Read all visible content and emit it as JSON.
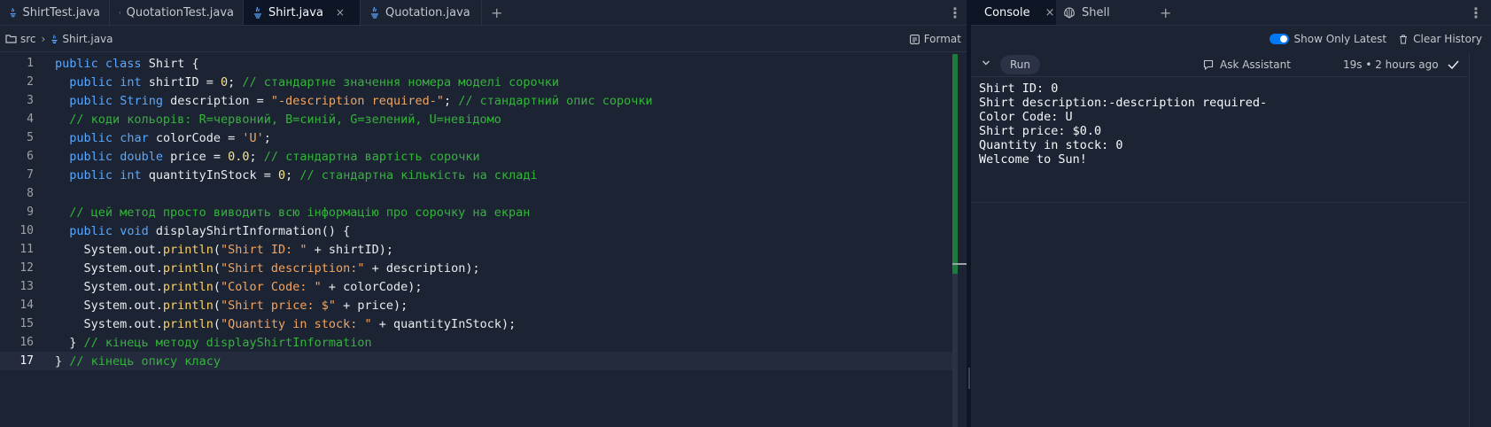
{
  "editor": {
    "tabs": [
      {
        "label": "ShirtTest.java",
        "active": false
      },
      {
        "label": "QuotationTest.java",
        "active": false
      },
      {
        "label": "Shirt.java",
        "active": true,
        "close": "×"
      },
      {
        "label": "Quotation.java",
        "active": false
      }
    ],
    "add_tab": "+",
    "menu": "⋮",
    "breadcrumb": {
      "folder": "src",
      "separator": "›",
      "file": "Shirt.java"
    },
    "format_label": "Format",
    "current_line": 17
  },
  "code_lines": [
    {
      "n": "1",
      "tokens": [
        {
          "c": "kw",
          "t": "public"
        },
        {
          "c": "id",
          "t": " "
        },
        {
          "c": "kw",
          "t": "class"
        },
        {
          "c": "id",
          "t": " Shirt {"
        }
      ]
    },
    {
      "n": "2",
      "tokens": [
        {
          "c": "id",
          "t": "  "
        },
        {
          "c": "kw",
          "t": "public"
        },
        {
          "c": "id",
          "t": " "
        },
        {
          "c": "ty",
          "t": "int"
        },
        {
          "c": "id",
          "t": " shirtID = "
        },
        {
          "c": "nm",
          "t": "0"
        },
        {
          "c": "id",
          "t": "; "
        },
        {
          "c": "cm",
          "t": "// стандартне значення номера моделі сорочки"
        }
      ]
    },
    {
      "n": "3",
      "tokens": [
        {
          "c": "id",
          "t": "  "
        },
        {
          "c": "kw",
          "t": "public"
        },
        {
          "c": "id",
          "t": " "
        },
        {
          "c": "ty",
          "t": "String"
        },
        {
          "c": "id",
          "t": " description = "
        },
        {
          "c": "st",
          "t": "\"-description required-\""
        },
        {
          "c": "id",
          "t": "; "
        },
        {
          "c": "cm",
          "t": "// стандартний опис сорочки"
        }
      ]
    },
    {
      "n": "4",
      "tokens": [
        {
          "c": "id",
          "t": "  "
        },
        {
          "c": "cm",
          "t": "// коди кольорів: R=червоний, B=синій, G=зелений, U=невідомо"
        }
      ]
    },
    {
      "n": "5",
      "tokens": [
        {
          "c": "id",
          "t": "  "
        },
        {
          "c": "kw",
          "t": "public"
        },
        {
          "c": "id",
          "t": " "
        },
        {
          "c": "ty",
          "t": "char"
        },
        {
          "c": "id",
          "t": " colorCode = "
        },
        {
          "c": "st",
          "t": "'U'"
        },
        {
          "c": "id",
          "t": ";"
        }
      ]
    },
    {
      "n": "6",
      "tokens": [
        {
          "c": "id",
          "t": "  "
        },
        {
          "c": "kw",
          "t": "public"
        },
        {
          "c": "id",
          "t": " "
        },
        {
          "c": "ty",
          "t": "double"
        },
        {
          "c": "id",
          "t": " price = "
        },
        {
          "c": "nm",
          "t": "0.0"
        },
        {
          "c": "id",
          "t": "; "
        },
        {
          "c": "cm",
          "t": "// стандартна вартість сорочки"
        }
      ]
    },
    {
      "n": "7",
      "tokens": [
        {
          "c": "id",
          "t": "  "
        },
        {
          "c": "kw",
          "t": "public"
        },
        {
          "c": "id",
          "t": " "
        },
        {
          "c": "ty",
          "t": "int"
        },
        {
          "c": "id",
          "t": " quantityInStock = "
        },
        {
          "c": "nm",
          "t": "0"
        },
        {
          "c": "id",
          "t": "; "
        },
        {
          "c": "cm",
          "t": "// стандартна кількість на складі"
        }
      ]
    },
    {
      "n": "8",
      "tokens": []
    },
    {
      "n": "9",
      "tokens": [
        {
          "c": "id",
          "t": "  "
        },
        {
          "c": "cm",
          "t": "// цей метод просто виводить всю інформацію про сорочку на екран"
        }
      ]
    },
    {
      "n": "10",
      "tokens": [
        {
          "c": "id",
          "t": "  "
        },
        {
          "c": "kw",
          "t": "public"
        },
        {
          "c": "id",
          "t": " "
        },
        {
          "c": "ty",
          "t": "void"
        },
        {
          "c": "id",
          "t": " displayShirtInformation() {"
        }
      ]
    },
    {
      "n": "11",
      "tokens": [
        {
          "c": "id",
          "t": "    System.out."
        },
        {
          "c": "fn",
          "t": "println"
        },
        {
          "c": "id",
          "t": "("
        },
        {
          "c": "st",
          "t": "\"Shirt ID: \""
        },
        {
          "c": "id",
          "t": " + shirtID);"
        }
      ]
    },
    {
      "n": "12",
      "tokens": [
        {
          "c": "id",
          "t": "    System.out."
        },
        {
          "c": "fn",
          "t": "println"
        },
        {
          "c": "id",
          "t": "("
        },
        {
          "c": "st",
          "t": "\"Shirt description:\""
        },
        {
          "c": "id",
          "t": " + description);"
        }
      ]
    },
    {
      "n": "13",
      "tokens": [
        {
          "c": "id",
          "t": "    System.out."
        },
        {
          "c": "fn",
          "t": "println"
        },
        {
          "c": "id",
          "t": "("
        },
        {
          "c": "st",
          "t": "\"Color Code: \""
        },
        {
          "c": "id",
          "t": " + colorCode);"
        }
      ]
    },
    {
      "n": "14",
      "tokens": [
        {
          "c": "id",
          "t": "    System.out."
        },
        {
          "c": "fn",
          "t": "println"
        },
        {
          "c": "id",
          "t": "("
        },
        {
          "c": "st",
          "t": "\"Shirt price: $\""
        },
        {
          "c": "id",
          "t": " + price);"
        }
      ]
    },
    {
      "n": "15",
      "tokens": [
        {
          "c": "id",
          "t": "    System.out."
        },
        {
          "c": "fn",
          "t": "println"
        },
        {
          "c": "id",
          "t": "("
        },
        {
          "c": "st",
          "t": "\"Quantity in stock: \""
        },
        {
          "c": "id",
          "t": " + quantityInStock);"
        }
      ]
    },
    {
      "n": "16",
      "tokens": [
        {
          "c": "id",
          "t": "  } "
        },
        {
          "c": "cm",
          "t": "// кінець методу displayShirtInformation"
        }
      ]
    },
    {
      "n": "17",
      "tokens": [
        {
          "c": "id",
          "t": "} "
        },
        {
          "c": "cm",
          "t": "// кінець опису класу"
        }
      ]
    }
  ],
  "console": {
    "tabs": [
      {
        "label": "Console",
        "icon": "terminal-icon",
        "active": true,
        "close": "×"
      },
      {
        "label": "Shell",
        "icon": "shell-icon",
        "active": false
      }
    ],
    "add_tab": "+",
    "menu": "⋮",
    "show_only_latest_label": "Show Only Latest",
    "clear_history_label": "Clear History",
    "run_label": "Run",
    "ask_assistant_label": "Ask Assistant",
    "timing": "19s • 2 hours ago",
    "output_lines": [
      "Shirt ID: 0",
      "Shirt description:-description required-",
      "Color Code: U",
      "Shirt price: $0.0",
      "Quantity in stock: 0",
      "Welcome to Sun!"
    ]
  },
  "colors": {
    "background": "#1c2333",
    "keyword": "#5aa8ff",
    "comment": "#35b33c",
    "string": "#f2a460",
    "number": "#f7e38f",
    "accent": "#0079f2"
  }
}
